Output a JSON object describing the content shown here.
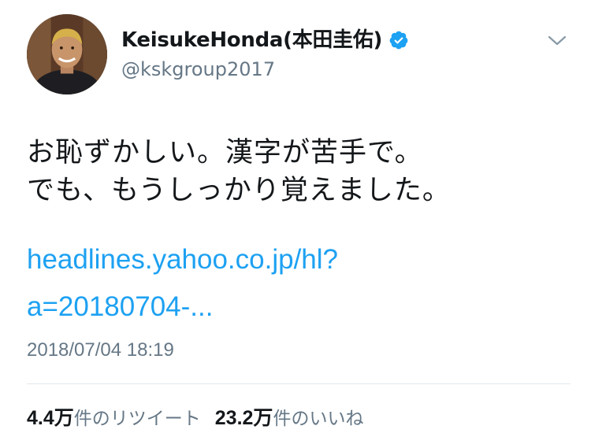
{
  "user": {
    "display_name": "KeisukeHonda(本田圭佑)",
    "handle": "@kskgroup2017",
    "verified": true
  },
  "tweet": {
    "text_lines": [
      "お恥ずかしい。漢字が苦手で。",
      "でも、もうしっかり覚えました。"
    ],
    "link_lines": [
      "headlines.yahoo.co.jp/hl?",
      "a=20180704-..."
    ],
    "timestamp": "2018/07/04 18:19"
  },
  "stats": {
    "retweets_count": "4.4万",
    "retweets_label": "件のリツイート",
    "likes_count": "23.2万",
    "likes_label": "件のいいね"
  },
  "colors": {
    "link": "#1da1f2",
    "secondary_text": "#657786",
    "verified_badge": "#1da1f2"
  },
  "icons": {
    "verified": "verified-badge-icon",
    "menu": "chevron-down-icon"
  }
}
